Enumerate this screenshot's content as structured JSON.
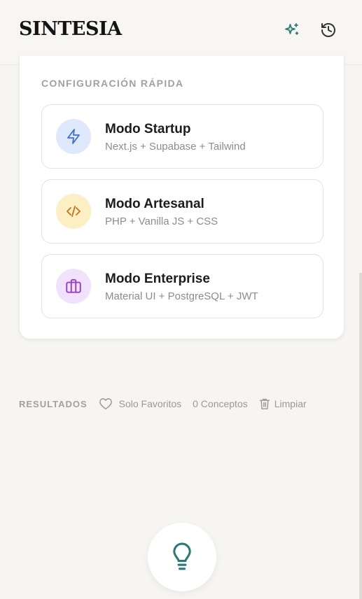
{
  "header": {
    "logo": "SINTESIA",
    "icons": {
      "sparkle": "sparkles-icon",
      "history": "history-icon"
    }
  },
  "quick_config": {
    "title": "CONFIGURACIÓN RÁPIDA",
    "modes": [
      {
        "title": "Modo Startup",
        "subtitle": "Next.js + Supabase + Tailwind",
        "icon": "zap-icon",
        "accent": "#3b6fd1",
        "bg": "#dfe9fb"
      },
      {
        "title": "Modo Artesanal",
        "subtitle": "PHP + Vanilla JS + CSS",
        "icon": "code-icon",
        "accent": "#c7791a",
        "bg": "#fcefc4"
      },
      {
        "title": "Modo Enterprise",
        "subtitle": "Material UI + PostgreSQL + JWT",
        "icon": "briefcase-icon",
        "accent": "#9a3fc4",
        "bg": "#f1e2fb"
      }
    ]
  },
  "results": {
    "label": "RESULTADOS",
    "favorites": "Solo Favoritos",
    "count": "0 Conceptos",
    "clear": "Limpiar"
  },
  "fab": {
    "icon": "lightbulb-icon",
    "color": "#2a7a78"
  },
  "colors": {
    "teal": "#2a7a78",
    "muted": "#a3a19c"
  }
}
